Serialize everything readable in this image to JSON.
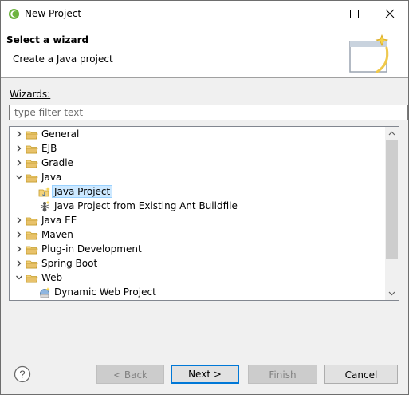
{
  "window": {
    "title": "New Project"
  },
  "banner": {
    "title": "Select a wizard",
    "description": "Create a Java project"
  },
  "wizards_label": "Wizards:",
  "filter": {
    "placeholder": "type filter text",
    "value": ""
  },
  "tree": [
    {
      "label": "General",
      "type": "folder",
      "expanded": false,
      "level": 0
    },
    {
      "label": "EJB",
      "type": "folder",
      "expanded": false,
      "level": 0
    },
    {
      "label": "Gradle",
      "type": "folder",
      "expanded": false,
      "level": 0
    },
    {
      "label": "Java",
      "type": "folder",
      "expanded": true,
      "level": 0
    },
    {
      "label": "Java Project",
      "type": "java-project-icon",
      "level": 1,
      "selected": true
    },
    {
      "label": "Java Project from Existing Ant Buildfile",
      "type": "ant-icon",
      "level": 1
    },
    {
      "label": "Java EE",
      "type": "folder",
      "expanded": false,
      "level": 0
    },
    {
      "label": "Maven",
      "type": "folder",
      "expanded": false,
      "level": 0
    },
    {
      "label": "Plug-in Development",
      "type": "folder",
      "expanded": false,
      "level": 0
    },
    {
      "label": "Spring Boot",
      "type": "folder",
      "expanded": false,
      "level": 0
    },
    {
      "label": "Web",
      "type": "folder",
      "expanded": true,
      "level": 0
    },
    {
      "label": "Dynamic Web Project",
      "type": "web-project-icon",
      "level": 1
    }
  ],
  "buttons": {
    "back": "< Back",
    "next": "Next >",
    "finish": "Finish",
    "cancel": "Cancel"
  },
  "colors": {
    "selection": "#cce8ff",
    "accent": "#0078d7",
    "folder": "#e8c26b"
  }
}
